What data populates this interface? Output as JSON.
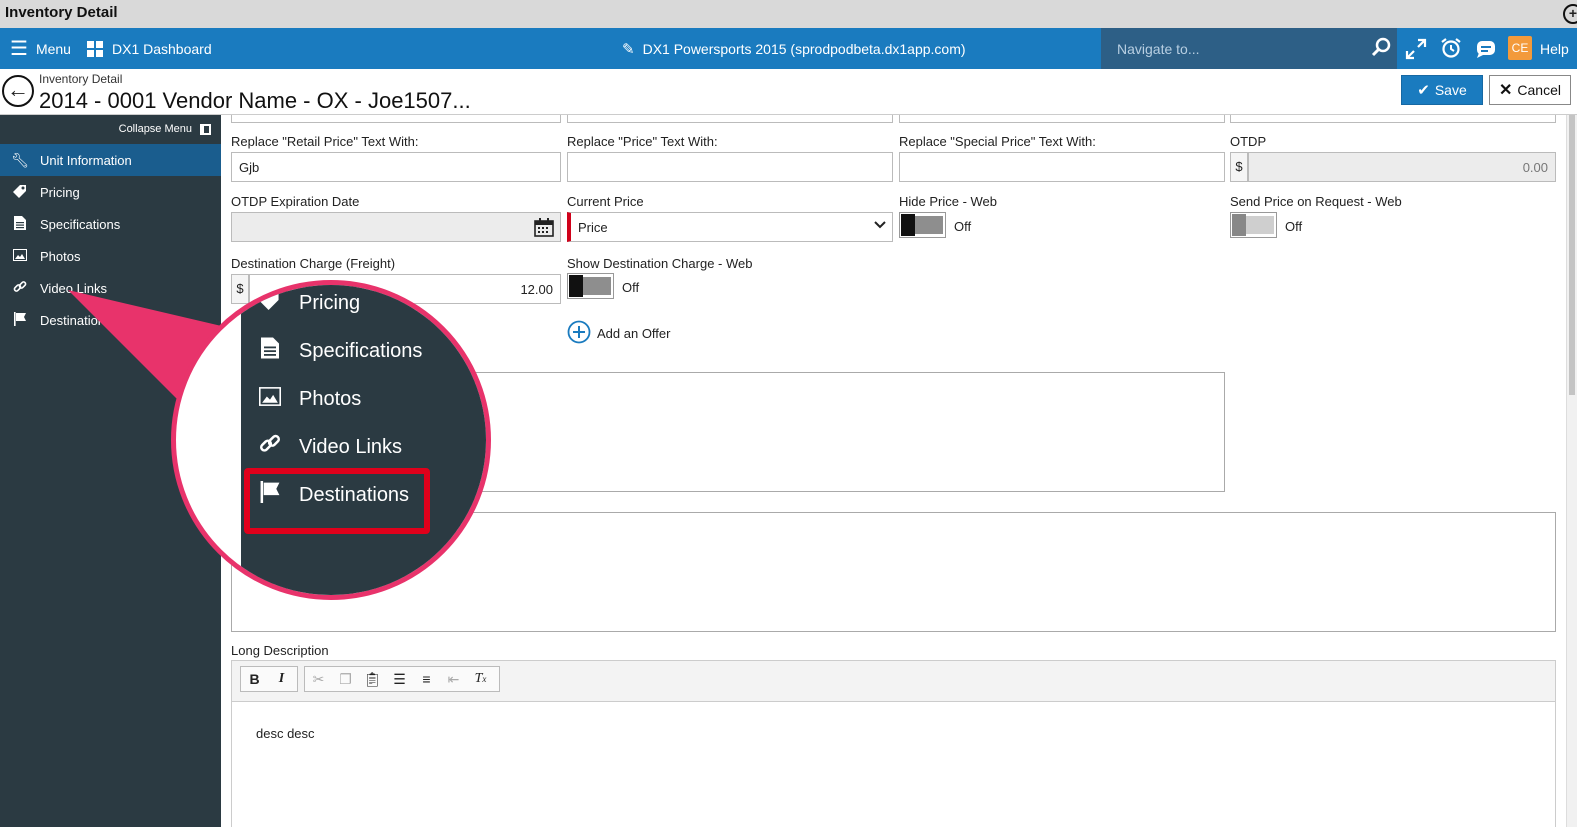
{
  "window": {
    "title": "Inventory Detail"
  },
  "topnav": {
    "menu_label": "Menu",
    "dashboard_label": "DX1 Dashboard",
    "site_label": "DX1 Powersports 2015 (sprodpodbeta.dx1app.com)",
    "search_placeholder": "Navigate to...",
    "user_initials": "CE",
    "help_label": "Help"
  },
  "header": {
    "breadcrumb": "Inventory Detail",
    "title": "2014 - 0001 Vendor Name - OX - Joe1507...",
    "save_label": "Save",
    "cancel_label": "Cancel"
  },
  "sidebar": {
    "collapse_label": "Collapse Menu",
    "items": [
      {
        "label": "Unit Information",
        "icon": "wrench-icon"
      },
      {
        "label": "Pricing",
        "icon": "tag-icon"
      },
      {
        "label": "Specifications",
        "icon": "document-icon"
      },
      {
        "label": "Photos",
        "icon": "photo-icon"
      },
      {
        "label": "Video Links",
        "icon": "link-icon"
      },
      {
        "label": "Destinations",
        "icon": "flag-icon"
      }
    ]
  },
  "form": {
    "retail_text_label": "Replace \"Retail Price\" Text With:",
    "retail_text_value": "Gjb",
    "price_text_label": "Replace \"Price\" Text With:",
    "price_text_value": "",
    "special_text_label": "Replace \"Special Price\" Text With:",
    "special_text_value": "",
    "otdp_label": "OTDP",
    "otdp_currency": "$",
    "otdp_value": "0.00",
    "otdp_exp_label": "OTDP Expiration Date",
    "current_price_label": "Current Price",
    "current_price_value": "Price",
    "hide_price_label": "Hide Price - Web",
    "hide_price_state": "Off",
    "send_price_label": "Send Price on Request - Web",
    "send_price_state": "Off",
    "dest_charge_label": "Destination Charge (Freight)",
    "dest_charge_currency": "$",
    "dest_charge_value": "12.00",
    "show_dest_label": "Show Destination Charge - Web",
    "show_dest_state": "Off",
    "add_offer_label": "Add an Offer",
    "long_desc_label": "Long Description",
    "long_desc_value": "desc desc"
  },
  "magnifier": {
    "items": [
      {
        "label": "Pricing"
      },
      {
        "label": "Specifications"
      },
      {
        "label": "Photos"
      },
      {
        "label": "Video Links"
      },
      {
        "label": "Destinations"
      }
    ],
    "highlight_color": "#e0001b",
    "ring_color": "#e8336b"
  },
  "colors": {
    "nav_blue": "#1a7bbf",
    "sidebar_bg": "#2b3a42",
    "sidebar_active": "#1a5d8e",
    "accent_orange": "#f39a3b"
  }
}
